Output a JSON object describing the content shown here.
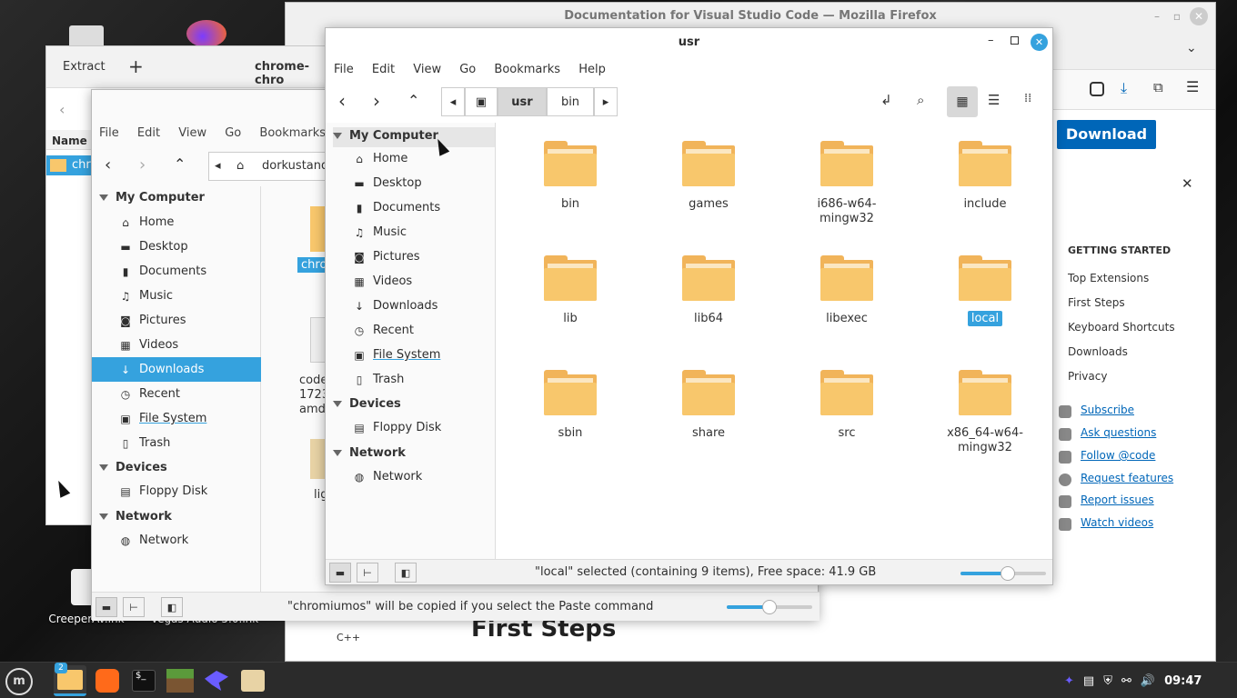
{
  "desktop": {
    "icons": [
      {
        "label": "CreeperAv.lnk"
      },
      {
        "label": "Vegas Audio 5.0.lnk"
      }
    ]
  },
  "firefox": {
    "title": "Documentation for Visual Studio Code — Mozilla Firefox",
    "download_label": "Download",
    "sidebar_heading": "GETTING STARTED",
    "sidebar_links": [
      "Top Extensions",
      "First Steps",
      "Keyboard Shortcuts",
      "Downloads",
      "Privacy"
    ],
    "social_links": [
      "Subscribe",
      "Ask questions",
      "Follow @code",
      "Request features",
      "Report issues",
      "Watch videos"
    ],
    "page_heading": "First Steps",
    "left_label": "C++",
    "close_glyph": "✕"
  },
  "extract": {
    "title": "Extract",
    "add_glyph": "+",
    "column_name": "Name",
    "row": "chro"
  },
  "back_window": {
    "title": "chrome-chro",
    "menu": [
      "File",
      "Edit",
      "View",
      "Go",
      "Bookmarks",
      "He"
    ],
    "path": "dorkustanda",
    "sidebar": {
      "my_computer": "My Computer",
      "items": [
        "Home",
        "Desktop",
        "Documents",
        "Music",
        "Pictures",
        "Videos",
        "Downloads",
        "Recent",
        "File System",
        "Trash"
      ],
      "devices": "Devices",
      "device_items": [
        "Floppy Disk"
      ],
      "network": "Network",
      "network_items": [
        "Network"
      ]
    },
    "files": [
      "chro",
      "code\n1723\namd",
      "lig"
    ],
    "status": "\"chromiumos\" will be copied if you select the Paste command",
    "zoom": 0.5
  },
  "usr_window": {
    "title": "usr",
    "menu": [
      "File",
      "Edit",
      "View",
      "Go",
      "Bookmarks",
      "Help"
    ],
    "breadcrumbs": [
      "usr",
      "bin"
    ],
    "sidebar": {
      "my_computer": "My Computer",
      "items": [
        "Home",
        "Desktop",
        "Documents",
        "Music",
        "Pictures",
        "Videos",
        "Downloads",
        "Recent",
        "File System",
        "Trash"
      ],
      "devices": "Devices",
      "device_items": [
        "Floppy Disk"
      ],
      "network": "Network",
      "network_items": [
        "Network"
      ]
    },
    "folders": [
      "bin",
      "games",
      "i686-w64-mingw32",
      "include",
      "lib",
      "lib64",
      "libexec",
      "local",
      "sbin",
      "share",
      "src",
      "x86_64-w64-mingw32"
    ],
    "selected_folder": "local",
    "status": "\"local\" selected (containing 9 items), Free space: 41.9 GB",
    "zoom": 0.55
  },
  "taskbar": {
    "badge": "2",
    "clock": "09:47"
  },
  "colors": {
    "accent": "#35a2de",
    "folder": "#f8c76c",
    "vscode_blue": "#0066b8"
  }
}
